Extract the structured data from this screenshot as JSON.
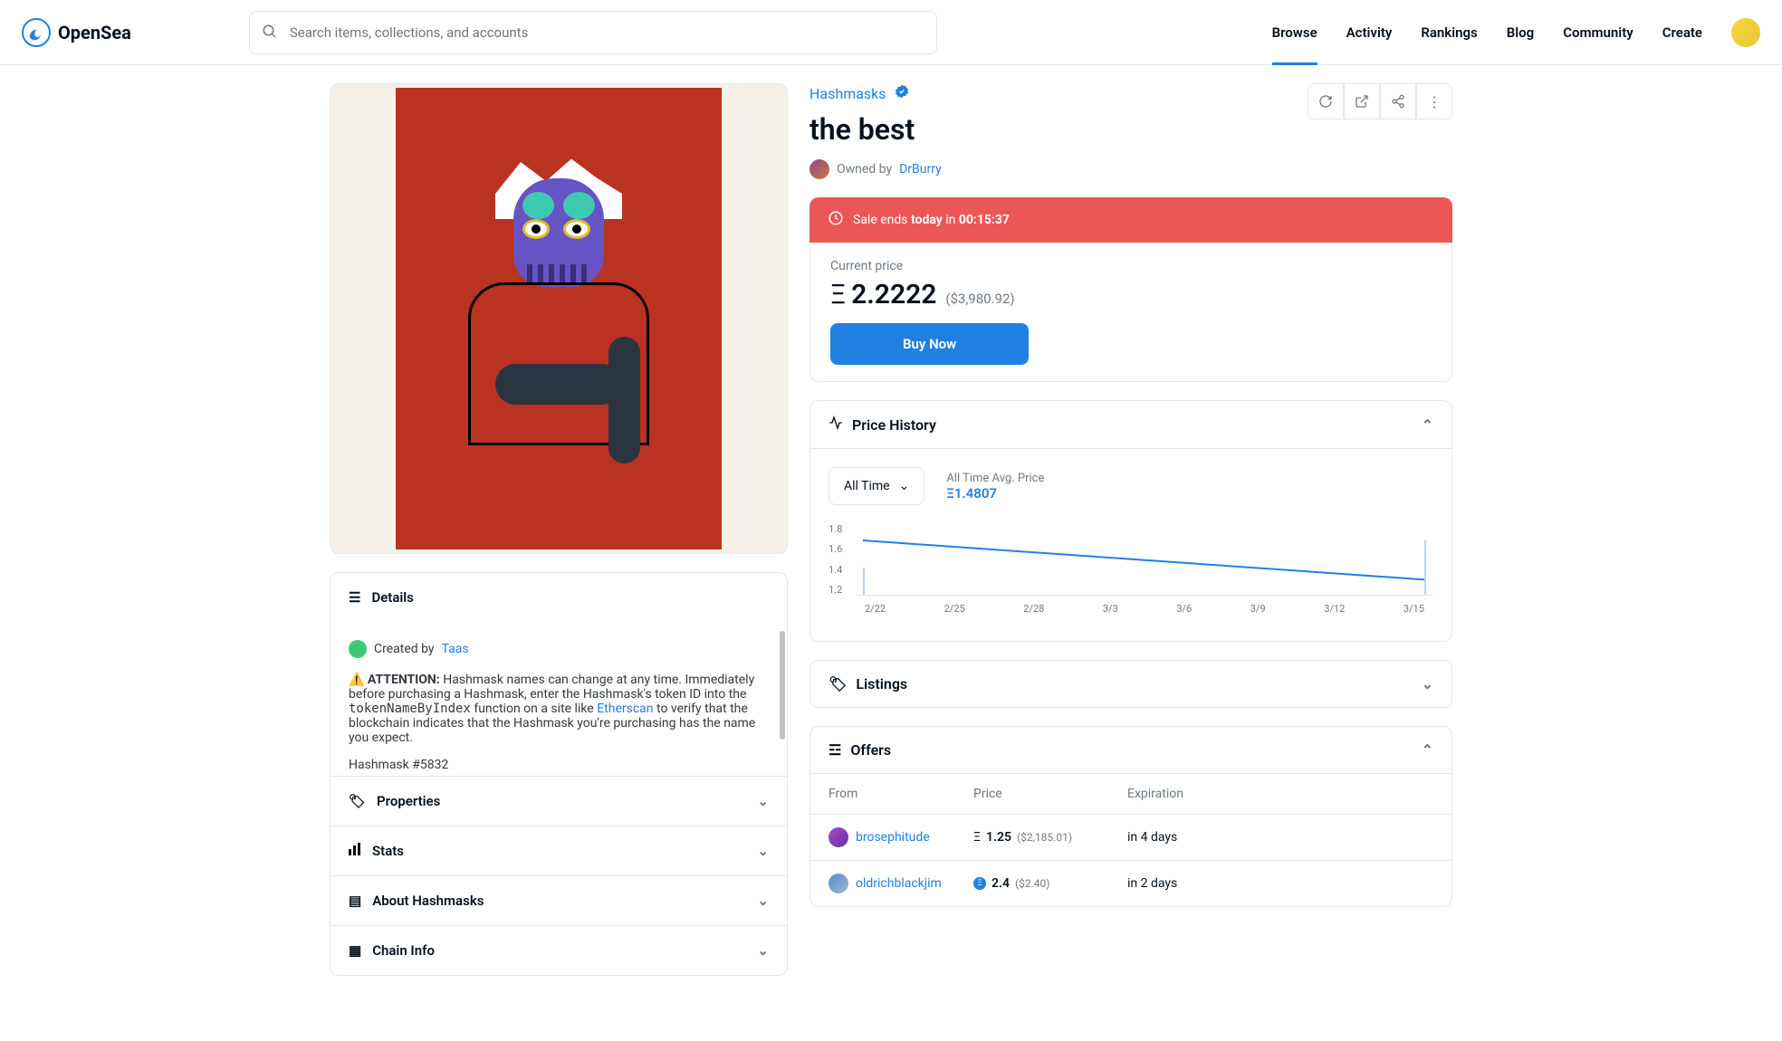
{
  "brand": "OpenSea",
  "search": {
    "placeholder": "Search items, collections, and accounts"
  },
  "nav": {
    "browse": "Browse",
    "activity": "Activity",
    "rankings": "Rankings",
    "blog": "Blog",
    "community": "Community",
    "create": "Create"
  },
  "collection": {
    "name": "Hashmasks"
  },
  "item": {
    "title": "the best",
    "owned_by_prefix": "Owned by ",
    "owner": "DrBurry"
  },
  "sale": {
    "prefix": "Sale ends ",
    "when": "today",
    "in": " in ",
    "countdown": "00:15:37"
  },
  "price": {
    "label": "Current price",
    "eth": "2.2222",
    "usd": "($3,980.92)",
    "buy": "Buy Now"
  },
  "details": {
    "header": "Details",
    "created_prefix": "Created by ",
    "creator": "Taas",
    "warn_emoji": "⚠️",
    "warn_label": " ATTENTION: ",
    "warn_text1": "Hashmask names can change at any time. Immediately before purchasing a Hashmask, enter the Hashmask's token ID into the ",
    "code": "tokenNameByIndex",
    "warn_text2": " function on a site like ",
    "etherscan": "Etherscan",
    "warn_text3": " to verify that the blockchain indicates that the Hashmask you're purchasing has the name you expect.",
    "hash_id": "Hashmask #5832"
  },
  "sections": {
    "properties": "Properties",
    "stats": "Stats",
    "about": "About Hashmasks",
    "chain": "Chain Info"
  },
  "history": {
    "header": "Price History",
    "time_range": "All Time",
    "avg_label": "All Time Avg. Price",
    "avg_value": "Ξ1.4807"
  },
  "chart_data": {
    "type": "line",
    "x": [
      "2/22",
      "2/25",
      "2/28",
      "3/3",
      "3/6",
      "3/9",
      "3/12",
      "3/15"
    ],
    "y_ticks": [
      "1.8",
      "1.6",
      "1.4",
      "1.2"
    ],
    "series": [
      {
        "name": "Price",
        "values": [
          1.7,
          1.65,
          1.58,
          1.52,
          1.46,
          1.4,
          1.34,
          1.28
        ]
      }
    ],
    "ylim": [
      1.2,
      1.8
    ],
    "ylabel": "",
    "xlabel": "",
    "title": ""
  },
  "listings": {
    "header": "Listings"
  },
  "offers": {
    "header": "Offers",
    "cols": {
      "from": "From",
      "price": "Price",
      "exp": "Expiration"
    },
    "rows": [
      {
        "user": "brosephitude",
        "sym": "Ξ",
        "price": "1.25",
        "usd": "($2,185.01)",
        "exp": "in 4 days",
        "dot": "dot-purple"
      },
      {
        "user": "oldrichblackjim",
        "sym": "weth",
        "price": "2.4",
        "usd": "($2.40)",
        "exp": "in 2 days",
        "dot": "dot-blue"
      }
    ]
  }
}
